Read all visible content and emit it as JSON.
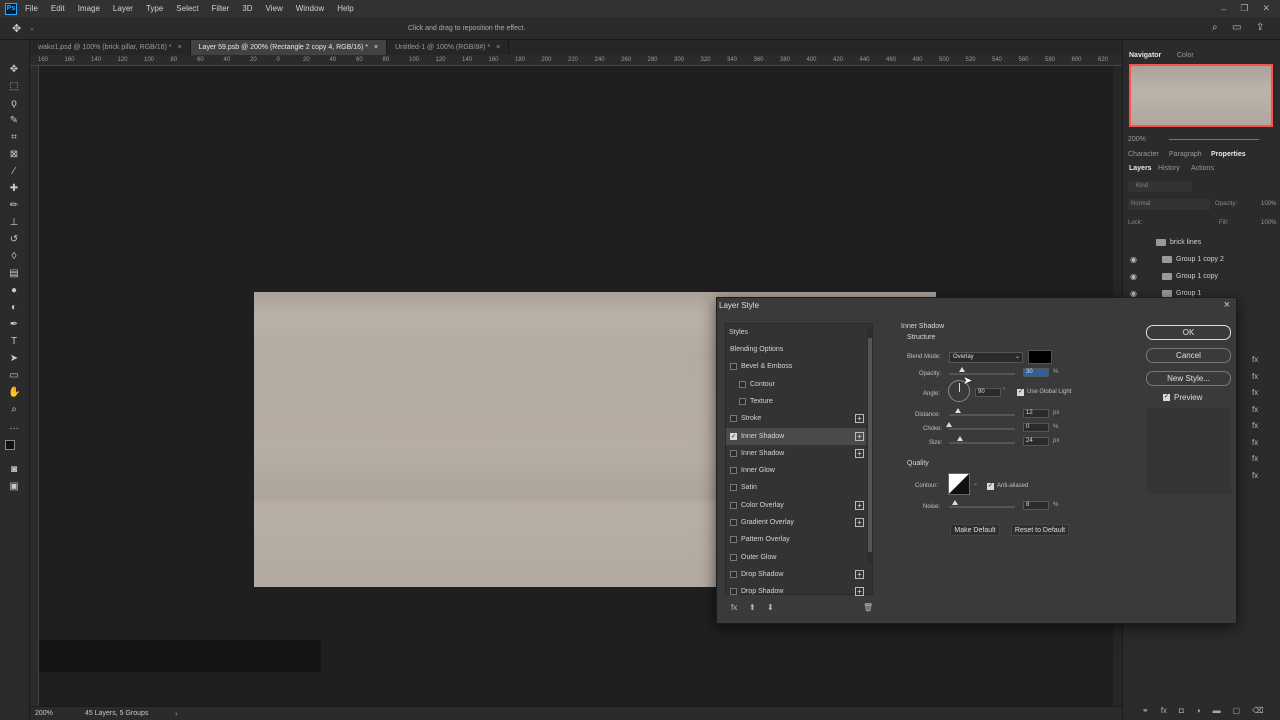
{
  "menubar": {
    "logo": "Ps",
    "items": [
      "File",
      "Edit",
      "Image",
      "Layer",
      "Type",
      "Select",
      "Filter",
      "3D",
      "View",
      "Window",
      "Help"
    ]
  },
  "options_hint": "Click and drag to reposition the effect.",
  "tabs": [
    {
      "label": "wako1.psd @ 100% (brick pillar, RGB/16) *",
      "active": false
    },
    {
      "label": "Layer 59.psb @ 200% (Rectangle 2 copy 4, RGB/16) *",
      "active": true
    },
    {
      "label": "Untitled-1 @ 100% (RGB/8#) *",
      "active": false
    }
  ],
  "ruler_ticks": [
    "160",
    "160",
    "140",
    "120",
    "100",
    "80",
    "60",
    "40",
    "20",
    "0",
    "20",
    "40",
    "60",
    "80",
    "100",
    "120",
    "140",
    "160",
    "180",
    "200",
    "220",
    "240",
    "260",
    "280",
    "300",
    "320",
    "340",
    "360",
    "380",
    "400",
    "420",
    "440",
    "460",
    "480",
    "500",
    "520",
    "540",
    "560",
    "580",
    "600",
    "620"
  ],
  "status": {
    "zoom": "200%",
    "info": "45 Layers, 5 Groups"
  },
  "right_panel": {
    "nav_tabs": [
      "Navigator",
      "Color"
    ],
    "nav_zoom": "200%",
    "prop_tabs": [
      "Character",
      "Paragraph",
      "Properties"
    ],
    "layer_tabs": [
      "Layers",
      "History",
      "Actions"
    ],
    "kind": "Kind",
    "blend": "Normal",
    "opacity_label": "Opacity:",
    "opacity": "100%",
    "lock_label": "Lock:",
    "fill_label": "Fill:",
    "fill": "100%",
    "layers": [
      "brick lines",
      "Group 1 copy 2",
      "Group 1 copy",
      "Group 1"
    ]
  },
  "dialog": {
    "title": "Layer Style",
    "styles_header": "Styles",
    "items": [
      {
        "label": "Blending Options",
        "check": false,
        "plus": false,
        "indent": 0,
        "checkbox": false
      },
      {
        "label": "Bevel & Emboss",
        "check": false,
        "plus": false,
        "indent": 0,
        "checkbox": true
      },
      {
        "label": "Contour",
        "check": false,
        "plus": false,
        "indent": 1,
        "checkbox": true
      },
      {
        "label": "Texture",
        "check": false,
        "plus": false,
        "indent": 1,
        "checkbox": true
      },
      {
        "label": "Stroke",
        "check": false,
        "plus": true,
        "indent": 0,
        "checkbox": true
      },
      {
        "label": "Inner Shadow",
        "check": true,
        "plus": true,
        "indent": 0,
        "checkbox": true,
        "selected": true
      },
      {
        "label": "Inner Shadow",
        "check": false,
        "plus": true,
        "indent": 0,
        "checkbox": true
      },
      {
        "label": "Inner Glow",
        "check": false,
        "plus": false,
        "indent": 0,
        "checkbox": true
      },
      {
        "label": "Satin",
        "check": false,
        "plus": false,
        "indent": 0,
        "checkbox": true
      },
      {
        "label": "Color Overlay",
        "check": false,
        "plus": true,
        "indent": 0,
        "checkbox": true
      },
      {
        "label": "Gradient Overlay",
        "check": false,
        "plus": true,
        "indent": 0,
        "checkbox": true
      },
      {
        "label": "Pattern Overlay",
        "check": false,
        "plus": false,
        "indent": 0,
        "checkbox": true
      },
      {
        "label": "Outer Glow",
        "check": false,
        "plus": false,
        "indent": 0,
        "checkbox": true
      },
      {
        "label": "Drop Shadow",
        "check": false,
        "plus": true,
        "indent": 0,
        "checkbox": true
      },
      {
        "label": "Drop Shadow",
        "check": false,
        "plus": true,
        "indent": 0,
        "checkbox": true
      }
    ],
    "fx": "fx",
    "section": "Inner Shadow",
    "structure": "Structure",
    "blend_mode_label": "Blend Mode:",
    "blend_mode": "Overlay",
    "shadow_color": "#000000",
    "opacity_label": "Opacity:",
    "opacity_value": "30",
    "opacity_level": 0.3,
    "angle_label": "Angle:",
    "angle_value": "90",
    "global_light": "Use Global Light",
    "distance_label": "Distance:",
    "distance_value": "12",
    "choke_label": "Choke:",
    "choke_value": "0",
    "size_label": "Size:",
    "size_value": "24",
    "px": "px",
    "pct": "%",
    "deg": "°",
    "quality": "Quality",
    "contour_label": "Contour:",
    "anti_aliased": "Anti-aliased",
    "noise_label": "Noise:",
    "noise_value": "8",
    "make_default": "Make Default",
    "reset_default": "Reset to Default",
    "ok": "OK",
    "cancel": "Cancel",
    "new_style": "New Style...",
    "preview": "Preview"
  }
}
